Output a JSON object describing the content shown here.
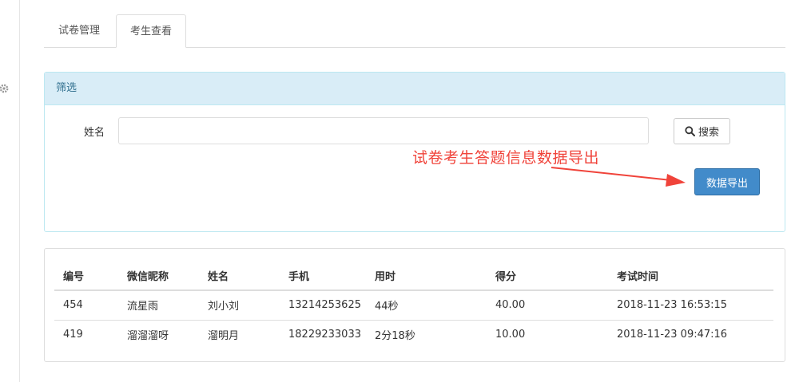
{
  "tabs": [
    {
      "label": "试卷管理",
      "active": false
    },
    {
      "label": "考生查看",
      "active": true
    }
  ],
  "filter": {
    "heading": "筛选",
    "name_label": "姓名",
    "name_value": "",
    "search_label": "搜索",
    "export_label": "数据导出"
  },
  "annotation": {
    "text": "试卷考生答题信息数据导出"
  },
  "table": {
    "columns": [
      "编号",
      "微信昵称",
      "姓名",
      "手机",
      "用时",
      "得分",
      "考试时间"
    ],
    "rows": [
      [
        "454",
        "流星雨",
        "刘小刘",
        "13214253625",
        "44秒",
        "40.00",
        "2018-11-23 16:53:15"
      ],
      [
        "419",
        "溜溜溜呀",
        "溜明月",
        "18229233033",
        "2分18秒",
        "10.00",
        "2018-11-23 09:47:16"
      ]
    ]
  },
  "colors": {
    "primary": "#428bca",
    "panel_heading": "#d9edf7",
    "annotation": "#f0433a"
  },
  "icons": [
    "gear-icon",
    "search-icon",
    "arrow-icon"
  ]
}
